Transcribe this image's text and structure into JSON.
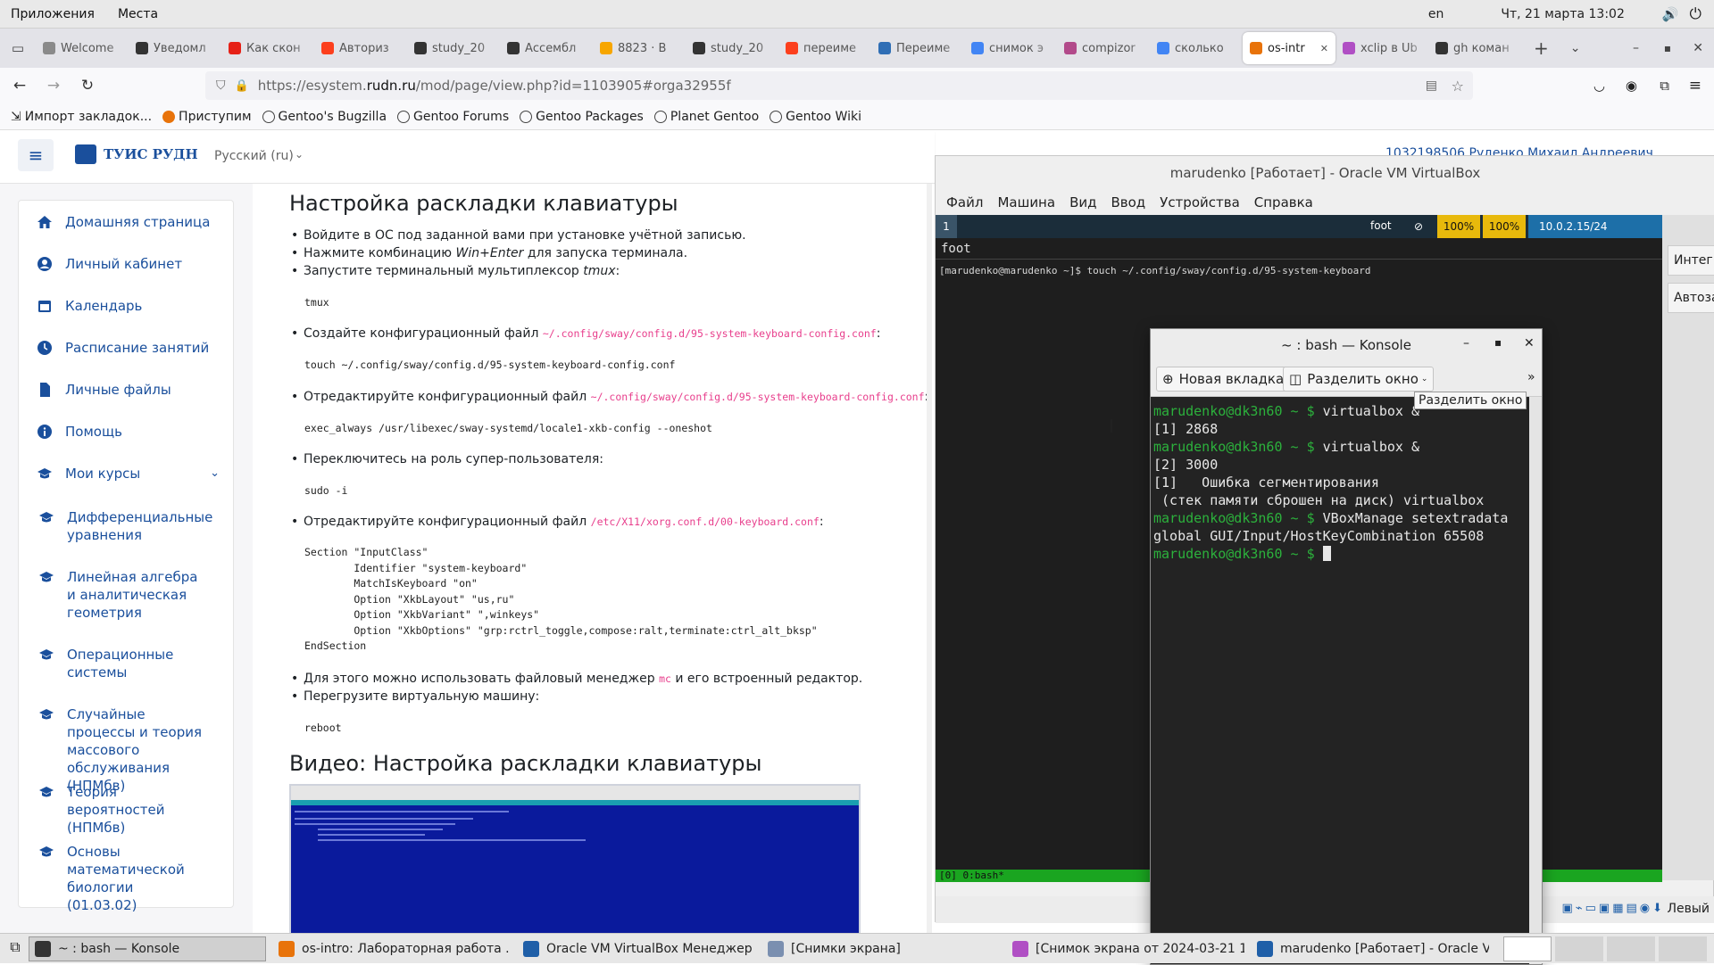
{
  "topbar": {
    "apps": "Приложения",
    "places": "Места",
    "lang": "en",
    "clock": "Чт, 21 марта  13:02"
  },
  "tabs": [
    {
      "label": "Welcome",
      "color": "#8a8a8a"
    },
    {
      "label": "Уведомл",
      "color": "#333333"
    },
    {
      "label": "Как скон",
      "color": "#e62117"
    },
    {
      "label": "Авториз",
      "color": "#fc3f1d"
    },
    {
      "label": "study_20",
      "color": "#333333"
    },
    {
      "label": "Ассембл",
      "color": "#333333"
    },
    {
      "label": "8823 · В",
      "color": "#f7a600"
    },
    {
      "label": "study_20",
      "color": "#333333"
    },
    {
      "label": "переиме",
      "color": "#fc3f1d"
    },
    {
      "label": "Переиме",
      "color": "#2f6eb5"
    },
    {
      "label": "снимок э",
      "color": "#4285f4"
    },
    {
      "label": "compizor",
      "color": "#b24a8a"
    },
    {
      "label": "сколько",
      "color": "#4285f4"
    },
    {
      "label": "os-intr",
      "color": "#e8730a",
      "active": true
    },
    {
      "label": "xclip в Ub",
      "color": "#b04fc4"
    },
    {
      "label": "gh коман",
      "color": "#333333"
    }
  ],
  "url": {
    "prefix": "https://esystem.",
    "domain": "rudn.ru",
    "path": "/mod/page/view.php?id=1103905#orga32955f"
  },
  "bookmarks": [
    "Импорт закладок...",
    "Приступим",
    "Gentoo's Bugzilla",
    "Gentoo Forums",
    "Gentoo Packages",
    "Planet Gentoo",
    "Gentoo Wiki"
  ],
  "site": {
    "brand": "ТУИС РУДН",
    "language": "Русский (ru)",
    "user": "1032198506 Руденко Михаил Андреевич"
  },
  "sidebar": [
    {
      "label": "Домашняя страница",
      "icon": "home-icon"
    },
    {
      "label": "Личный кабинет",
      "icon": "user-icon"
    },
    {
      "label": "Календарь",
      "icon": "calendar-icon"
    },
    {
      "label": "Расписание занятий",
      "icon": "clock-icon"
    },
    {
      "label": "Личные файлы",
      "icon": "file-icon"
    },
    {
      "label": "Помощь",
      "icon": "info-icon"
    },
    {
      "label": "Мои курсы",
      "icon": "graduation-icon"
    }
  ],
  "courses": [
    "Дифференциальные уравнения",
    "Линейная алгебра и аналитическая геометрия",
    "Операционные системы",
    "Случайные процессы и теория массового обслуживания (НПМбв)",
    "Теория вероятностей (НПМбв)",
    "Основы математической биологии (01.03.02)"
  ],
  "article": {
    "h1": "Настройка раскладки клавиатуры",
    "s1": "Войдите в ОС под заданной вами при установке учётной записью.",
    "s2a": "Нажмите комбинацию ",
    "s2b": "Win+Enter",
    "s2c": " для запуска терминала.",
    "s3a": "Запустите терминальный мультиплексор ",
    "s3b": "tmux",
    "c1": "tmux",
    "s4": "Создайте конфигурационный файл ",
    "path1": "~/.config/sway/config.d/95-system-keyboard-config.conf",
    "c2": "touch ~/.config/sway/config.d/95-system-keyboard-config.conf",
    "s5": "Отредактируйте конфигурационный файл ",
    "c3": "exec_always /usr/libexec/sway-systemd/locale1-xkb-config --oneshot",
    "s6": "Переключитесь на роль супер-пользователя:",
    "c4": "sudo -i",
    "s7": "Отредактируйте конфигурационный файл ",
    "path2": "/etc/X11/xorg.conf.d/00-keyboard.conf",
    "c5": "Section \"InputClass\"\n        Identifier \"system-keyboard\"\n        MatchIsKeyboard \"on\"\n        Option \"XkbLayout\" \"us,ru\"\n        Option \"XkbVariant\" \",winkeys\"\n        Option \"XkbOptions\" \"grp:rctrl_toggle,compose:ralt,terminate:ctrl_alt_bksp\"\nEndSection",
    "s8a": "Для этого можно использовать файловый менеджер ",
    "s8b": "mc",
    "s8c": " и его встроенный редактор.",
    "s9": "Перегрузите виртуальную машину:",
    "c6": "reboot",
    "h2": "Видео: Настройка раскладки клавиатуры"
  },
  "vbox": {
    "title": "marudenko [Работает] - Oracle VM VirtualBox",
    "menu": [
      "Файл",
      "Машина",
      "Вид",
      "Ввод",
      "Устройства",
      "Справка"
    ],
    "ws": "1",
    "foot": "foot",
    "vol1": "100%",
    "vol2": "100%",
    "ip": "10.0.2.15/24",
    "termtitle": "foot",
    "cmd": "[marudenko@marudenko ~]$ touch ~/.config/sway/config.d/95-system-keyboard",
    "tmux": "[0] 0:bash*",
    "side1": "Интеграция м",
    "side2": "Автозахват к",
    "hostkey": "Левый"
  },
  "konsole": {
    "title": "~ : bash — Konsole",
    "newtab": "Новая вкладка",
    "split": "Разделить окно",
    "tooltip": "Разделить окно",
    "lines": [
      {
        "p": "marudenko@dk3n60 ~ $ ",
        "t": "virtualbox &"
      },
      {
        "t": "[1] 2868"
      },
      {
        "p": "marudenko@dk3n60 ~ $ ",
        "t": "virtualbox &"
      },
      {
        "t": "[2] 3000"
      },
      {
        "t": "[1]   Ошибка сегментирования"
      },
      {
        "t": " (стек памяти сброшен на диск) virtualbox"
      },
      {
        "p": "marudenko@dk3n60 ~ $ ",
        "t": "VBoxManage setextradata"
      },
      {
        "t": "global GUI/Input/HostKeyCombination 65508"
      },
      {
        "p": "marudenko@dk3n60 ~ $ ",
        "t": ""
      }
    ]
  },
  "taskbar": [
    {
      "label": "~ : bash — Konsole",
      "color": "#333333",
      "active": true
    },
    {
      "label": "os-intro: Лабораторная работа ...",
      "color": "#e8730a"
    },
    {
      "label": "Oracle VM VirtualBox Менеджер",
      "color": "#1f5fa8"
    },
    {
      "label": "[Снимки экрана]",
      "color": "#7a8fb0"
    },
    {
      "label": "[Снимок экрана от 2024-03-21 1...",
      "color": "#b04fc4"
    },
    {
      "label": "marudenko [Работает] - Oracle V...",
      "color": "#1f5fa8"
    }
  ]
}
